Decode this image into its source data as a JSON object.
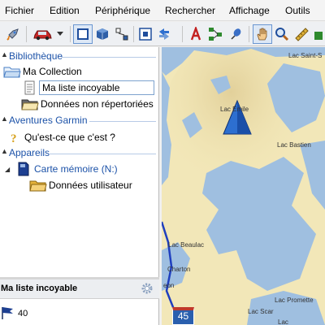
{
  "menubar": {
    "items": [
      "Fichier",
      "Edition",
      "Périphérique",
      "Rechercher",
      "Affichage",
      "Outils"
    ]
  },
  "toolbar": {
    "icons": [
      "rocket-icon",
      "car-icon",
      "dropdown-arrow-icon",
      "rectangle-select-icon",
      "cube-icon",
      "nodes-icon",
      "target-icon",
      "refresh-icon",
      "text-tool-icon",
      "route-tool-icon",
      "pin-tool-icon",
      "hand-tool-icon",
      "zoom-tool-icon",
      "measure-tool-icon"
    ]
  },
  "tree": {
    "library_label": "Bibliothèque",
    "collection_label": "Ma Collection",
    "my_list_label": "Ma liste incoyable",
    "unlisted_label": "Données non répertoriées",
    "garmin_label": "Aventures Garmin",
    "whatis_label": "Qu'est-ce que c'est ?",
    "devices_label": "Appareils",
    "memory_card_label": "Carte mémoire (N:)",
    "user_data_label": "Données utilisateur"
  },
  "bottom_panel": {
    "title": "Ma liste incoyable",
    "count": "40"
  },
  "map": {
    "labels": {
      "lac_saint": "Lac Saint-S",
      "lac_emile": "Lac Émile",
      "lac_bastien": "Lac Bastien",
      "lac_beaulac": "Lac Beaulac",
      "charton": "Charton",
      "eon": "eon",
      "lac_scar": "Lac Scar",
      "lac_promette": "Lac Promette",
      "lac_bottom": "Lac"
    },
    "road_number": "45",
    "water_color": "#9fbfe0",
    "land_color": "#f2e7b8",
    "marker_color": "#2d6fd0"
  }
}
